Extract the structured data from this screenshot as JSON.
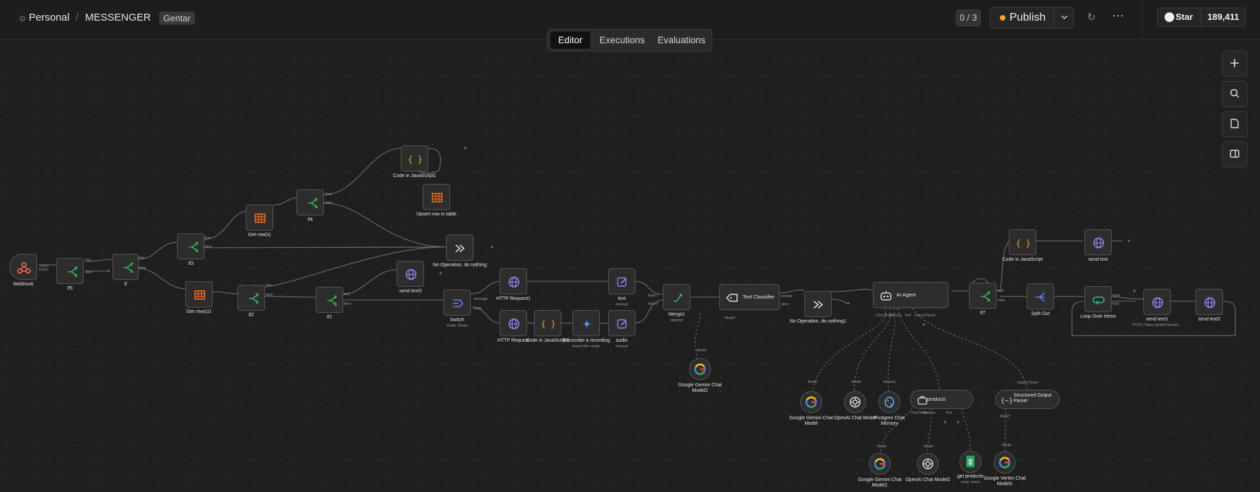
{
  "header": {
    "breadcrumb_project": "Personal",
    "workflow_name": "MESSENGER",
    "tag": "Gentar",
    "counter": "0 / 3",
    "publish_label": "Publish",
    "github_star_label": "Star",
    "github_star_count": "189,411"
  },
  "tabs": [
    {
      "label": "Editor",
      "active": true
    },
    {
      "label": "Executions",
      "active": false
    },
    {
      "label": "Evaluations",
      "active": false
    }
  ],
  "toolbar": [
    "zoom-in-icon",
    "search-icon",
    "notes-icon",
    "panel-icon"
  ],
  "nodes": {
    "webhook": {
      "label": "Webhook",
      "icon": "webhook-icon",
      "color": "#ff6d5a"
    },
    "if5": {
      "label": "If5",
      "icon": "if-icon",
      "color": "#35b55a"
    },
    "if": {
      "label": "If",
      "icon": "if-icon",
      "color": "#35b55a"
    },
    "if3": {
      "label": "If3",
      "icon": "if-icon",
      "color": "#35b55a"
    },
    "get_rows": {
      "label": "Get row(s)",
      "icon": "table-icon",
      "color": "#f26b21"
    },
    "if4": {
      "label": "If4",
      "icon": "if-icon",
      "color": "#35b55a"
    },
    "code_js1": {
      "label": "Code in JavaScript1",
      "icon": "code-icon",
      "color": "#f5a623"
    },
    "upsert": {
      "label": "Upsert row in table",
      "icon": "table-icon",
      "color": "#f26b21"
    },
    "noop": {
      "label": "No Operation, do nothing",
      "icon": "arrow-icon",
      "color": "#dddddd"
    },
    "get_rows1": {
      "label": "Get row(s)1",
      "icon": "table-icon",
      "color": "#f26b21"
    },
    "if2": {
      "label": "If2",
      "icon": "if-icon",
      "color": "#35b55a"
    },
    "if1": {
      "label": "If1",
      "icon": "if-icon",
      "color": "#35b55a"
    },
    "send_text3": {
      "label": "send text3",
      "icon": "globe-icon",
      "color": "#8b8cf5"
    },
    "switch": {
      "label": "Switch",
      "sub": "mode: Rules",
      "icon": "switch-icon",
      "color": "#6b7cf5"
    },
    "http1": {
      "label": "HTTP Request1",
      "icon": "globe-icon",
      "color": "#8b8cf5"
    },
    "http": {
      "label": "HTTP Request",
      "icon": "globe-icon",
      "color": "#8b8cf5"
    },
    "code_js2": {
      "label": "Code in JavaScript2",
      "icon": "code-icon",
      "color": "#f5a623"
    },
    "transcribe": {
      "label": "Transcribe a recording",
      "sub": "transcribe: audio",
      "icon": "gemini-icon",
      "color": "#4f8ff7"
    },
    "text": {
      "label": "text",
      "sub": "manual",
      "icon": "edit-icon",
      "color": "#8b8cf5"
    },
    "audio": {
      "label": "audio",
      "sub": "manual",
      "icon": "edit-icon",
      "color": "#8b8cf5"
    },
    "merge1": {
      "label": "Merge1",
      "sub": "append",
      "icon": "merge-icon",
      "color": "#35b55a"
    },
    "classifier": {
      "label": "Text Classifier",
      "icon": "tag-icon",
      "color": "#dddddd"
    },
    "noop1": {
      "label": "No Operation, do nothing1",
      "icon": "arrow-icon",
      "color": "#dddddd"
    },
    "agent": {
      "label": "AI Agent",
      "icon": "robot-icon",
      "color": "#dddddd"
    },
    "if7": {
      "label": "If7",
      "icon": "if-icon",
      "color": "#35b55a"
    },
    "code_js": {
      "label": "Code in JavaScript",
      "icon": "code-icon",
      "color": "#f5a623"
    },
    "send_text": {
      "label": "send text",
      "icon": "globe-icon",
      "color": "#8b8cf5"
    },
    "split_out": {
      "label": "Split Out",
      "icon": "split-icon",
      "color": "#6b7cf5"
    },
    "loop": {
      "label": "Loop Over Items",
      "icon": "loop-icon",
      "color": "#35b5a0"
    },
    "send_text1": {
      "label": "send text1",
      "sub": "POST: https://graph.facebo...",
      "icon": "globe-icon",
      "color": "#8b8cf5"
    },
    "send_text2": {
      "label": "send text2",
      "icon": "globe-icon",
      "color": "#8b8cf5"
    },
    "gemini2": {
      "label": "Google Gemini Chat Model2",
      "icon": "google-icon"
    },
    "gemini": {
      "label": "Google Gemini Chat Model",
      "icon": "google-icon"
    },
    "openai": {
      "label": "OpenAI Chat Model",
      "icon": "openai-icon"
    },
    "postgres": {
      "label": "Postgres Chat Memory",
      "icon": "postgres-icon"
    },
    "products": {
      "label": "products",
      "icon": "tool-icon"
    },
    "parser": {
      "label": "Structured Output Parser",
      "icon": "braces-icon"
    },
    "gemini1": {
      "label": "Google Gemini Chat Model1",
      "icon": "google-icon"
    },
    "openai2": {
      "label": "OpenAI Chat Model2",
      "icon": "openai-icon"
    },
    "get_products": {
      "label": "get products",
      "sub": "read: sheet",
      "icon": "sheets-icon"
    },
    "vertex": {
      "label": "Google Vertex Chat Model1",
      "icon": "google-icon"
    }
  },
  "port_labels": {
    "webhook_items": "1 item",
    "webhook_method": "POST",
    "true": "true",
    "false": "false",
    "message": "message",
    "audio": "audio",
    "input1": "Input 1",
    "input2": "Input 2",
    "product": "product",
    "other": "other",
    "model": "Model",
    "model_req": "Model*",
    "memory": "Memory",
    "tool": "Tool",
    "output_parser": "Output Parser",
    "done": "done",
    "loop": "loop",
    "agent_ports": [
      "Chat Model",
      "Memory",
      "Tool",
      "Output Parser"
    ],
    "products_ports": [
      "Chat Model",
      "Memory",
      "Tool"
    ]
  }
}
